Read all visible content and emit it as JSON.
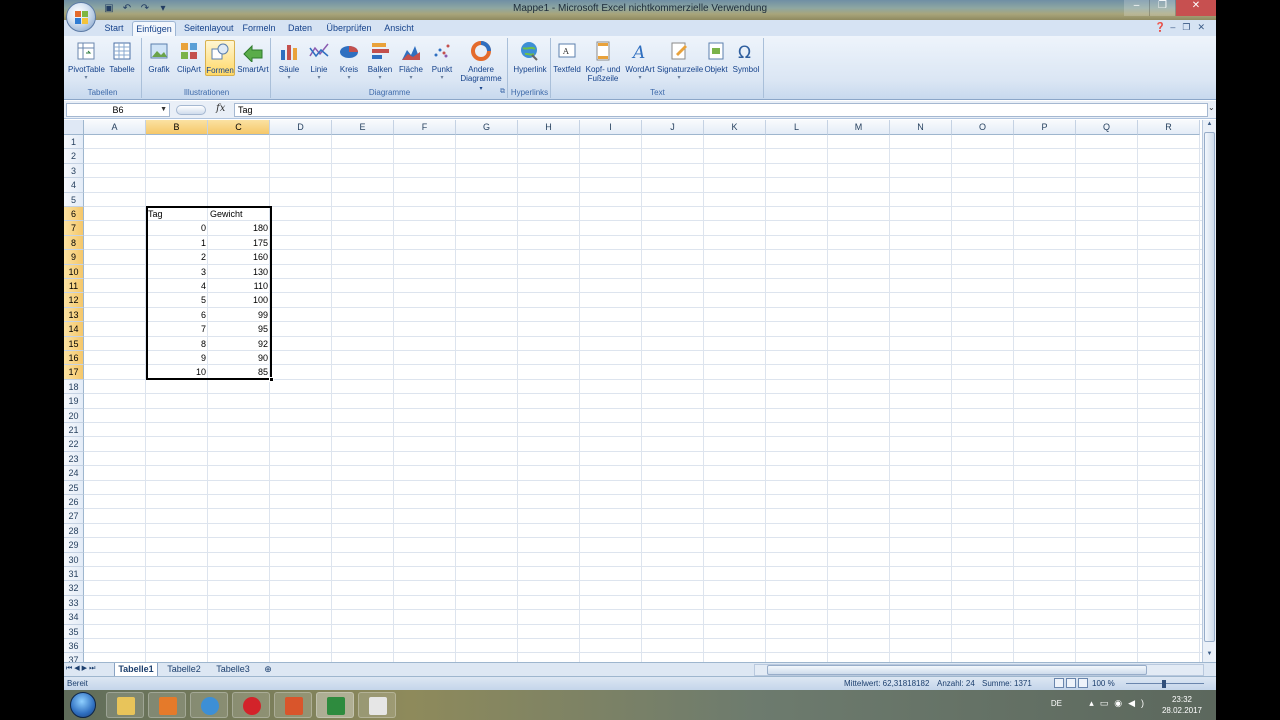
{
  "window": {
    "title": "Mappe1 - Microsoft Excel nichtkommerzielle Verwendung"
  },
  "tabs": [
    "Start",
    "Einfügen",
    "Seitenlayout",
    "Formeln",
    "Daten",
    "Überprüfen",
    "Ansicht"
  ],
  "active_tab": "Einfügen",
  "ribbon": {
    "groups": {
      "tabellen": {
        "label": "Tabellen",
        "buttons": [
          "PivotTable",
          "Tabelle"
        ]
      },
      "illustrationen": {
        "label": "Illustrationen",
        "buttons": [
          "Grafik",
          "ClipArt",
          "Formen",
          "SmartArt"
        ]
      },
      "diagramme": {
        "label": "Diagramme",
        "buttons": [
          "Säule",
          "Linie",
          "Kreis",
          "Balken",
          "Fläche",
          "Punkt"
        ],
        "andere_line1": "Andere",
        "andere_line2": "Diagramme"
      },
      "hyperlinks": {
        "label": "Hyperlinks",
        "buttons": [
          "Hyperlink"
        ]
      },
      "text": {
        "label": "Text",
        "textfeld": "Textfeld",
        "kopf_line1": "Kopf- und",
        "kopf_line2": "Fußzeile",
        "wordart": "WordArt",
        "signatur": "Signaturzeile",
        "objekt": "Objekt",
        "symbol": "Symbol"
      }
    }
  },
  "formula_bar": {
    "name_box": "B6",
    "fx": "fx",
    "content": "Tag"
  },
  "sheet": {
    "columns": [
      "A",
      "B",
      "C",
      "D",
      "E",
      "F",
      "G",
      "H",
      "I",
      "J",
      "K",
      "L",
      "M",
      "N",
      "O",
      "P",
      "Q",
      "R"
    ],
    "rows": [
      "1",
      "2",
      "3",
      "4",
      "5",
      "6",
      "7",
      "8",
      "9",
      "10",
      "11",
      "12",
      "13",
      "14",
      "15",
      "16",
      "17",
      "18",
      "19",
      "20",
      "21",
      "22",
      "23",
      "24",
      "25",
      "26",
      "27",
      "28",
      "29",
      "30",
      "31",
      "32",
      "33",
      "34",
      "35",
      "36",
      "37"
    ],
    "header_tag": "Tag",
    "header_gewicht": "Gewicht",
    "data": [
      {
        "tag": "0",
        "gewicht": "180"
      },
      {
        "tag": "1",
        "gewicht": "175"
      },
      {
        "tag": "2",
        "gewicht": "160"
      },
      {
        "tag": "3",
        "gewicht": "130"
      },
      {
        "tag": "4",
        "gewicht": "110"
      },
      {
        "tag": "5",
        "gewicht": "100"
      },
      {
        "tag": "6",
        "gewicht": "99"
      },
      {
        "tag": "7",
        "gewicht": "95"
      },
      {
        "tag": "8",
        "gewicht": "92"
      },
      {
        "tag": "9",
        "gewicht": "90"
      },
      {
        "tag": "10",
        "gewicht": "85"
      }
    ]
  },
  "sheet_tabs": [
    "Tabelle1",
    "Tabelle2",
    "Tabelle3"
  ],
  "status": {
    "ready": "Bereit",
    "mittelwert": "Mittelwert: 62,31818182",
    "anzahl": "Anzahl: 24",
    "summe": "Summe: 1371",
    "zoom": "100 %"
  },
  "taskbar": {
    "lang": "DE",
    "time": "23:32",
    "date": "28.02.2017"
  },
  "colors": {
    "ribbon_bg": "#dbe6f4",
    "selected_header": "#f5c76a",
    "tab_text": "#15428b"
  }
}
